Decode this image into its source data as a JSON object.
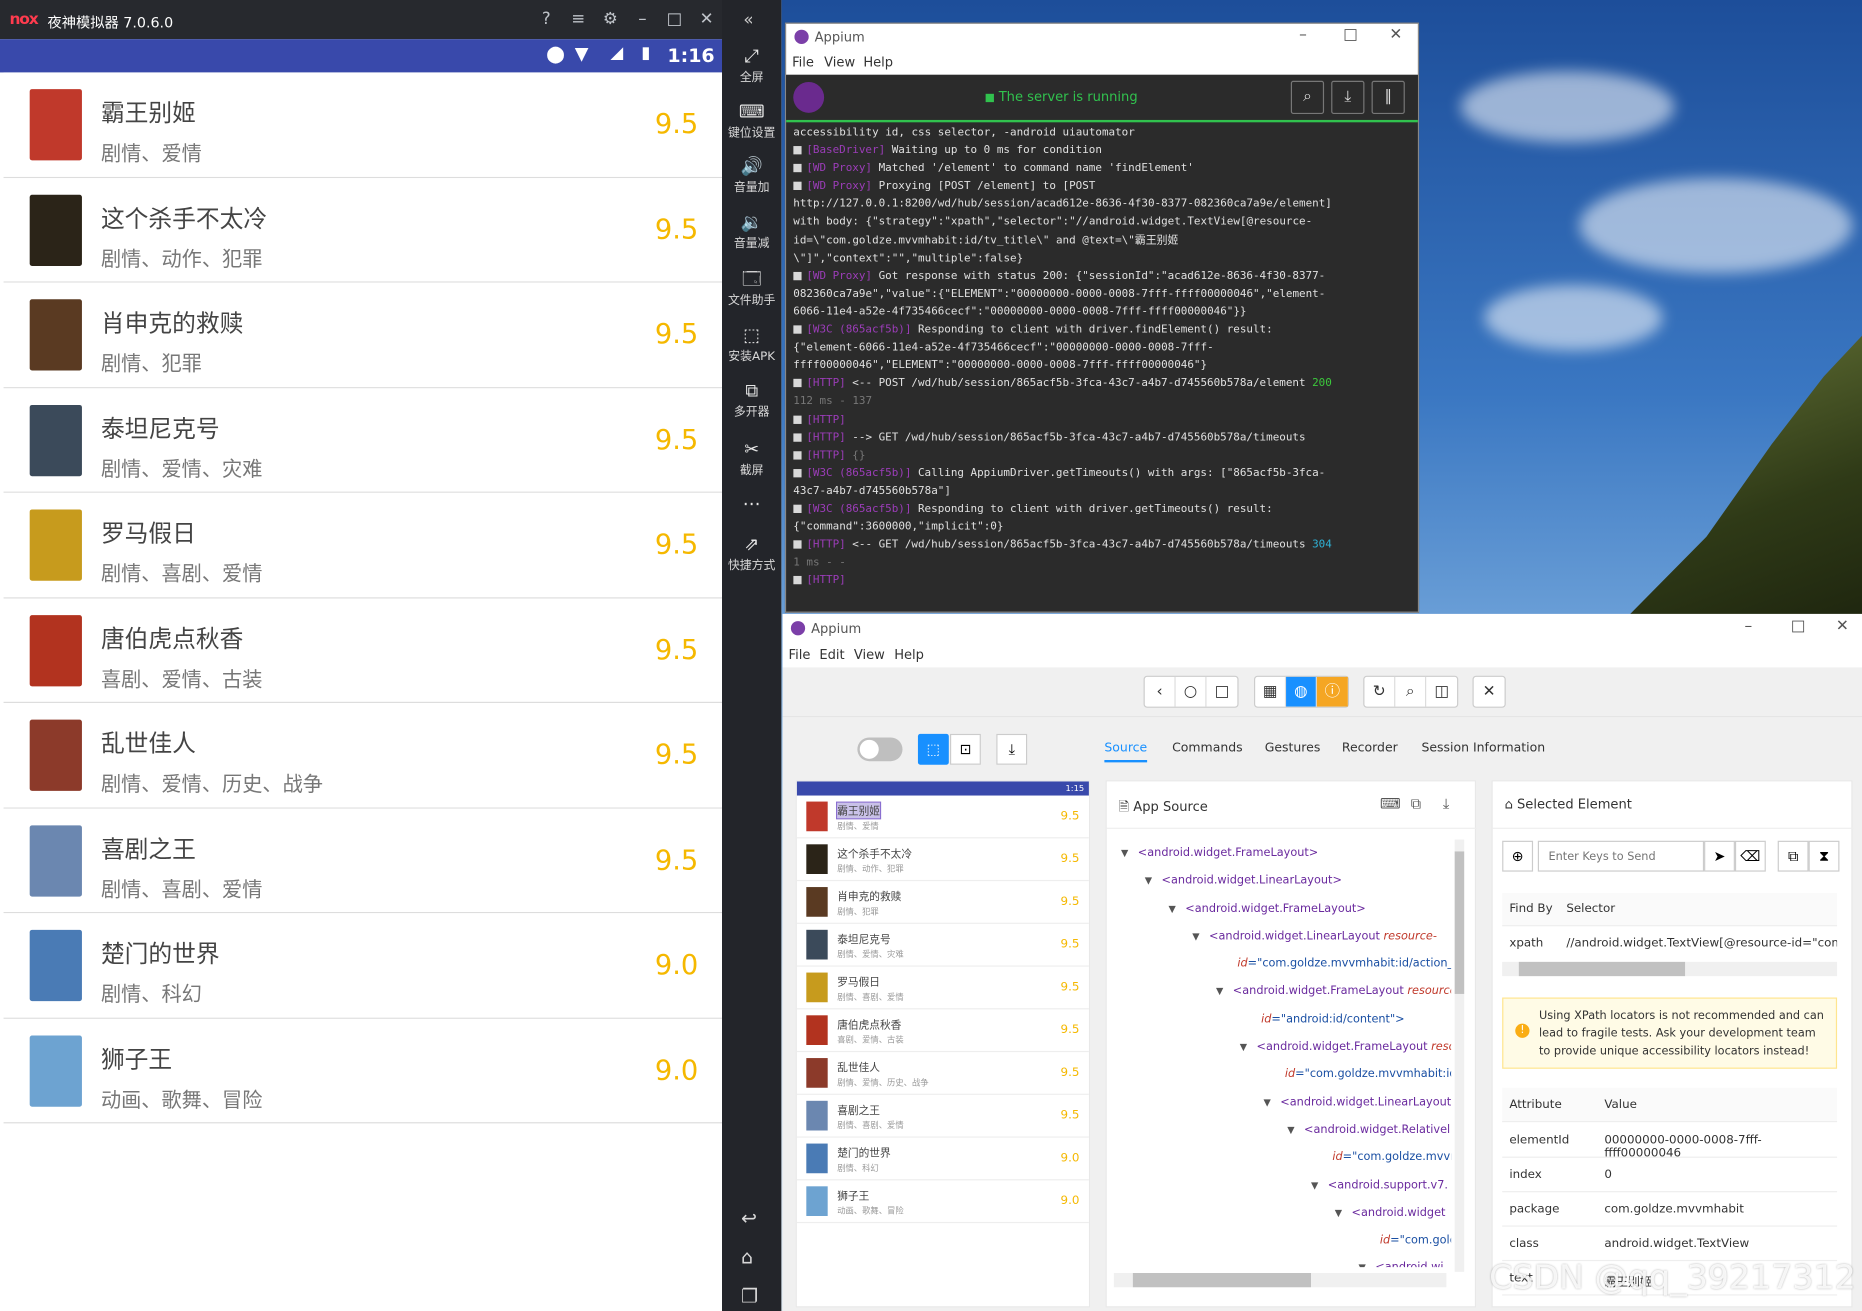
{
  "nox": {
    "logo": "nox",
    "title": "夜神模拟器 7.0.6.0",
    "time": "1:16",
    "sidebar": [
      {
        "label": "全屏",
        "icon": "fullscreen-icon",
        "glyph": "⤢"
      },
      {
        "label": "键位设置",
        "icon": "keyboard-icon",
        "glyph": "⌨"
      },
      {
        "label": "音量加",
        "icon": "volume-up-icon",
        "glyph": "🔊"
      },
      {
        "label": "音量减",
        "icon": "volume-down-icon",
        "glyph": "🔉"
      },
      {
        "label": "文件助手",
        "icon": "file-icon",
        "glyph": "🗔"
      },
      {
        "label": "安装APK",
        "icon": "apk-icon",
        "glyph": "⬚"
      },
      {
        "label": "多开器",
        "icon": "multi-instance-icon",
        "glyph": "⧉"
      },
      {
        "label": "截屏",
        "icon": "scissors-icon",
        "glyph": "✂"
      },
      {
        "label": "",
        "icon": "more-icon",
        "glyph": "⋯"
      },
      {
        "label": "快捷方式",
        "icon": "shortcut-icon",
        "glyph": "⇗"
      }
    ],
    "movies": [
      {
        "title": "霸王别姬",
        "genre": "剧情、爱情",
        "score": "9.5",
        "color": "#c0392b"
      },
      {
        "title": "这个杀手不太冷",
        "genre": "剧情、动作、犯罪",
        "score": "9.5",
        "color": "#2b2418"
      },
      {
        "title": "肖申克的救赎",
        "genre": "剧情、犯罪",
        "score": "9.5",
        "color": "#5a3a22"
      },
      {
        "title": "泰坦尼克号",
        "genre": "剧情、爱情、灾难",
        "score": "9.5",
        "color": "#3b4a5a"
      },
      {
        "title": "罗马假日",
        "genre": "剧情、喜剧、爱情",
        "score": "9.5",
        "color": "#c79b1d"
      },
      {
        "title": "唐伯虎点秋香",
        "genre": "喜剧、爱情、古装",
        "score": "9.5",
        "color": "#b2331f"
      },
      {
        "title": "乱世佳人",
        "genre": "剧情、爱情、历史、战争",
        "score": "9.5",
        "color": "#8c3a2a"
      },
      {
        "title": "喜剧之王",
        "genre": "剧情、喜剧、爱情",
        "score": "9.5",
        "color": "#6b87b0"
      },
      {
        "title": "楚门的世界",
        "genre": "剧情、科幻",
        "score": "9.0",
        "color": "#4a7bb5"
      },
      {
        "title": "狮子王",
        "genre": "动画、歌舞、冒险",
        "score": "9.0",
        "color": "#6da3d1"
      }
    ]
  },
  "server": {
    "app_name": "Appium",
    "menu": [
      "File",
      "View",
      "Help"
    ],
    "status": "The server is running",
    "log": [
      [
        [
          "",
          "accessibility id, css selector, -android uiautomator"
        ]
      ],
      [
        [
          "tag",
          "[BaseDriver]"
        ],
        [
          "",
          " Waiting up to 0 ms for condition"
        ]
      ],
      [
        [
          "tag",
          "[WD Proxy]"
        ],
        [
          "",
          " Matched '/element' to command name 'findElement'"
        ]
      ],
      [
        [
          "tag",
          "[WD Proxy]"
        ],
        [
          "",
          " Proxying [POST /element] to [POST"
        ]
      ],
      [
        [
          "",
          "http://127.0.0.1:8200/wd/hub/session/acad612e-8636-4f30-8377-082360ca7a9e/element]"
        ]
      ],
      [
        [
          "",
          "with body: {\"strategy\":\"xpath\",\"selector\":\"//android.widget.TextView[@resource-"
        ]
      ],
      [
        [
          "",
          "id=\\\"com.goldze.mvvmhabit:id/tv_title\\\" and @text=\\\"霸王别姬"
        ]
      ],
      [
        [
          "",
          "\\\"]\",\"context\":\"\",\"multiple\":false}"
        ]
      ],
      [
        [
          "tag",
          "[WD Proxy]"
        ],
        [
          "",
          " Got response with status 200: {\"sessionId\":\"acad612e-8636-4f30-8377-"
        ]
      ],
      [
        [
          "",
          "082360ca7a9e\",\"value\":{\"ELEMENT\":\"00000000-0000-0008-7fff-ffff00000046\",\"element-"
        ]
      ],
      [
        [
          "",
          "6066-11e4-a52e-4f735466cecf\":\"00000000-0000-0008-7fff-ffff00000046\"}}"
        ]
      ],
      [
        [
          "tag",
          "[W3C (865acf5b)]"
        ],
        [
          "",
          " Responding to client with driver.findElement() result:"
        ]
      ],
      [
        [
          "",
          "{\"element-6066-11e4-a52e-4f735466cecf\":\"00000000-0000-0008-7fff-"
        ]
      ],
      [
        [
          "",
          "ffff00000046\",\"ELEMENT\":\"00000000-0000-0008-7fff-ffff00000046\"}"
        ]
      ],
      [
        [
          "tag",
          "[HTTP]"
        ],
        [
          "",
          " <-- POST /wd/hub/session/865acf5b-3fca-43c7-a4b7-d745560b578a/element "
        ],
        [
          "b200",
          "200"
        ]
      ],
      [
        [
          "dim",
          "112 ms - 137"
        ]
      ],
      [
        [
          "tag",
          "[HTTP]"
        ]
      ],
      [
        [
          "tag",
          "[HTTP]"
        ],
        [
          "",
          " --> GET /wd/hub/session/865acf5b-3fca-43c7-a4b7-d745560b578a/timeouts"
        ]
      ],
      [
        [
          "tag",
          "[HTTP]"
        ],
        [
          "dim",
          " {}"
        ]
      ],
      [
        [
          "tag",
          "[W3C (865acf5b)]"
        ],
        [
          "",
          " Calling AppiumDriver.getTimeouts() with args: [\"865acf5b-3fca-"
        ]
      ],
      [
        [
          "",
          "43c7-a4b7-d745560b578a\"]"
        ]
      ],
      [
        [
          "tag",
          "[W3C (865acf5b)]"
        ],
        [
          "",
          " Responding to client with driver.getTimeouts() result:"
        ]
      ],
      [
        [
          "",
          "{\"command\":3600000,\"implicit\":0}"
        ]
      ],
      [
        [
          "tag",
          "[HTTP]"
        ],
        [
          "",
          " <-- GET /wd/hub/session/865acf5b-3fca-43c7-a4b7-d745560b578a/timeouts "
        ],
        [
          "b304",
          "304"
        ]
      ],
      [
        [
          "dim",
          "1 ms - -"
        ]
      ],
      [
        [
          "tag",
          "[HTTP]"
        ]
      ]
    ]
  },
  "inspector": {
    "app_name": "Appium",
    "menu": [
      "File",
      "Edit",
      "View",
      "Help"
    ],
    "tabs": [
      "Source",
      "Commands",
      "Gestures",
      "Recorder",
      "Session Information"
    ],
    "app_source_title": "App Source",
    "selected_title": "Selected Element",
    "send_keys_placeholder": "Enter Keys to Send",
    "find_by_header": "Find By",
    "selector_header": "Selector",
    "find_by": "xpath",
    "selector": "//android.widget.TextView[@resource-id=\"com.gol",
    "warning": "Using XPath locators is not recommended and can lead to fragile tests. Ask your development team to provide unique accessibility locators instead!",
    "attr_header": "Attribute",
    "value_header": "Value",
    "attributes": [
      {
        "k": "elementId",
        "v": "00000000-0000-0008-7fff-ffff00000046"
      },
      {
        "k": "index",
        "v": "0"
      },
      {
        "k": "package",
        "v": "com.goldze.mvvmhabit"
      },
      {
        "k": "class",
        "v": "android.widget.TextView"
      },
      {
        "k": "text",
        "v": "霸王别姬"
      }
    ],
    "mini_time": "1:15",
    "tree": [
      {
        "d": 0,
        "tag": "<android.widget.FrameLayout>",
        "attr": "",
        "val": ""
      },
      {
        "d": 1,
        "tag": "<android.widget.LinearLayout>",
        "attr": "",
        "val": ""
      },
      {
        "d": 2,
        "tag": "<android.widget.FrameLayout>",
        "attr": "",
        "val": ""
      },
      {
        "d": 3,
        "tag": "<android.widget.LinearLayout ",
        "attr": "resource-",
        "val": ""
      },
      {
        "d": 4,
        "tag": "",
        "attr": "id",
        "val": "=\"com.goldze.mvvmhabit:id/action_bar_ro"
      },
      {
        "d": 4,
        "tag": "<android.widget.FrameLayout ",
        "attr": "resource-",
        "val": ""
      },
      {
        "d": 5,
        "tag": "",
        "attr": "id",
        "val": "=\"android:id/content\">"
      },
      {
        "d": 5,
        "tag": "<android.widget.FrameLayout ",
        "attr": "reso",
        "val": ""
      },
      {
        "d": 6,
        "tag": "",
        "attr": "id",
        "val": "=\"com.goldze.mvvmhabit:id/con"
      },
      {
        "d": 6,
        "tag": "<android.widget.LinearLayout",
        "attr": "",
        "val": ""
      },
      {
        "d": 7,
        "tag": "<android.widget.Relativel",
        "attr": "",
        "val": ""
      },
      {
        "d": 8,
        "tag": "",
        "attr": "id",
        "val": "=\"com.goldze.mvvmhab"
      },
      {
        "d": 8,
        "tag": "<android.support.v7.",
        "attr": "",
        "val": ""
      },
      {
        "d": 9,
        "tag": "<android.widget",
        "attr": "",
        "val": ""
      },
      {
        "d": 10,
        "tag": "",
        "attr": "id",
        "val": "=\"com.goldze."
      },
      {
        "d": 10,
        "tag": "<android.wi",
        "attr": "",
        "val": ""
      }
    ]
  },
  "watermark": "CSDN @qq_39217312",
  "colors": {
    "accent": "#1890ff",
    "server_green": "#31c24e",
    "score": "#f5b800",
    "status_bar": "#3949ab"
  }
}
